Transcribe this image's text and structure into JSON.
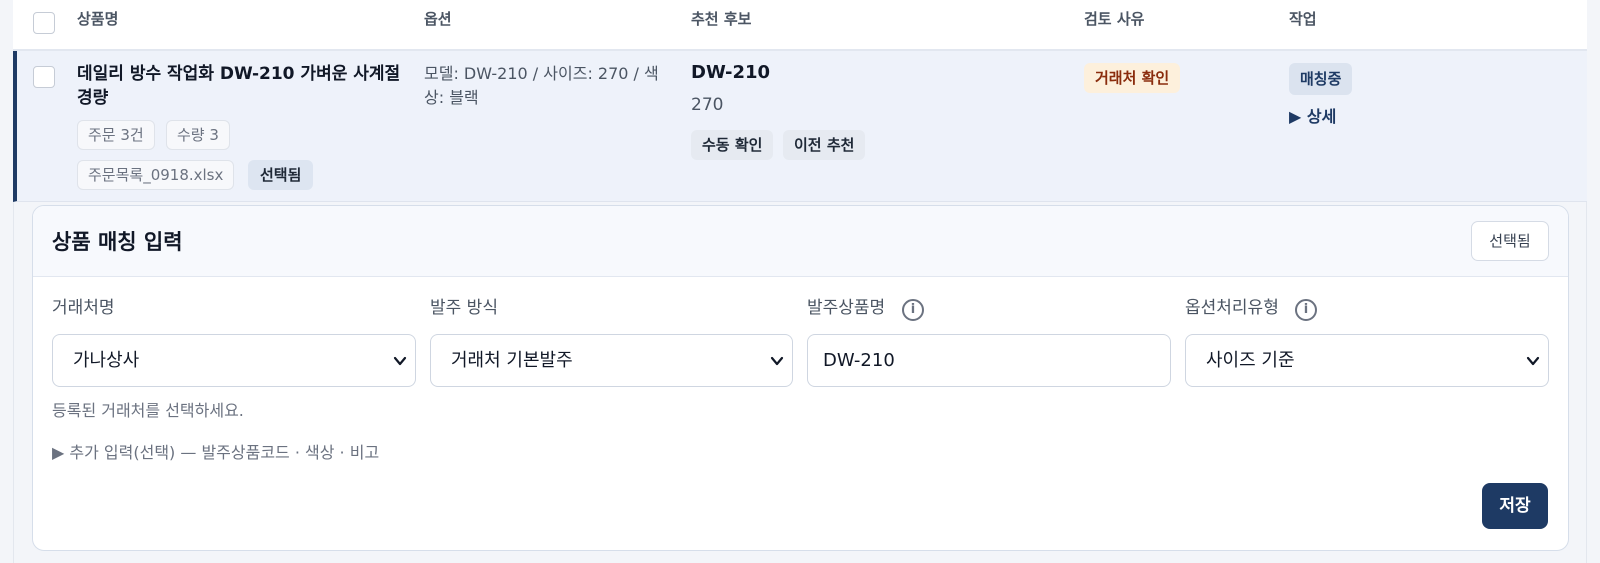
{
  "table": {
    "headers": {
      "product": "상품명",
      "option": "옵션",
      "recommend": "추천 후보",
      "reason": "검토 사유",
      "action": "작업"
    }
  },
  "row": {
    "product_name": "데일리 방수 작업화 DW-210 가벼운 사계절 경량",
    "chips": {
      "orders": "주문 3건",
      "qty": "수량 3",
      "file": "주문목록_0918.xlsx",
      "selected": "선택됨"
    },
    "option_text": "모델: DW-210 / 사이즈: 270 / 색상: 블랙",
    "recommend": {
      "code": "DW-210",
      "size": "270",
      "manual_btn": "수동 확인",
      "prev_btn": "이전 추천"
    },
    "reason_badge": "거래처 확인",
    "status_badge": "매칭중",
    "detail_link": "▶ 상세"
  },
  "panel": {
    "title": "상품 매칭 입력",
    "selected_btn": "선택됨",
    "fields": {
      "vendor": {
        "label": "거래처명",
        "value": "가나상사"
      },
      "order_method": {
        "label": "발주 방식",
        "value": "거래처 기본발주"
      },
      "order_product": {
        "label": "발주상품명",
        "value": "DW-210"
      },
      "option_type": {
        "label": "옵션처리유형",
        "value": "사이즈 기준"
      }
    },
    "hint": "등록된 거래처를 선택하세요.",
    "more": "▶  추가 입력(선택) — 발주상품코드 · 색상 · 비고",
    "save": "저장"
  },
  "colors": {
    "accent": "#1e3a64",
    "row_bg": "#eef2fa",
    "warn_text": "#8a2c0d",
    "warn_bg": "#fdf0dc"
  },
  "icons": [
    "info-icon",
    "chevron-down-icon",
    "caret-right-icon"
  ]
}
